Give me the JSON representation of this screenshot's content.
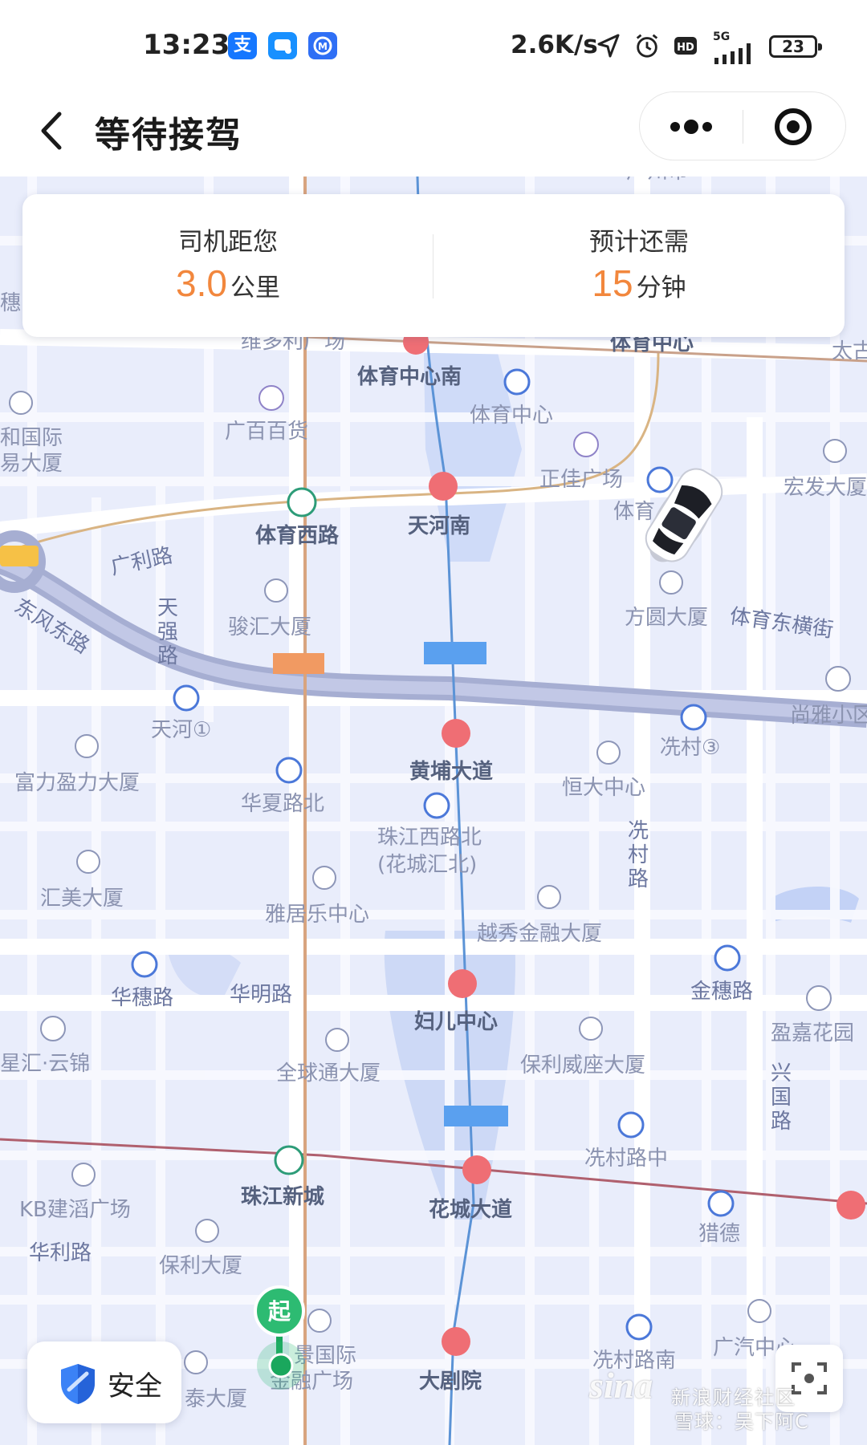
{
  "status_bar": {
    "time": "13:23",
    "net_speed": "2.6K/s",
    "network": "5G",
    "battery": "23",
    "icons": [
      "alipay-app-icon",
      "chat-app-icon",
      "mobile-app-icon",
      "location-arrow-icon",
      "alarm-icon",
      "hd-icon",
      "signal-icon",
      "battery-icon"
    ]
  },
  "header": {
    "title": "等待接驾",
    "back_icon": "chevron-left-icon",
    "more_icon": "more-dots-icon",
    "close_icon": "target-circle-icon"
  },
  "info_card": {
    "distance_label": "司机距您",
    "distance_value": "3.0",
    "distance_unit": "公里",
    "eta_label": "预计还需",
    "eta_value": "15",
    "eta_unit": "分钟"
  },
  "map": {
    "accent_color": "#f2873d",
    "start_marker": "起",
    "labels": [
      "体育中心南",
      "体育中心",
      "体育中心",
      "广百百货",
      "正佳广场",
      "体育",
      "宏发大厦",
      "和国际",
      "易大厦",
      "体育西路",
      "天河南",
      "广利路",
      "天",
      "强",
      "路",
      "东风东路",
      "骏汇大厦",
      "方圆大厦",
      "体育东横街",
      "天河①",
      "尚雅小区",
      "冼村③",
      "黄埔大道",
      "富力盈力大厦",
      "华夏路北",
      "恒大中心",
      "珠江西路北",
      "(花城汇北)",
      "冼",
      "村",
      "路",
      "汇美大厦",
      "雅居乐中心",
      "越秀金融大厦",
      "华穗路",
      "华明路",
      "金穗路",
      "妇儿中心",
      "盈嘉花园",
      "星汇·云锦",
      "全球通大厦",
      "保利威座大厦",
      "兴",
      "国",
      "路",
      "冼村路中",
      "珠江新城",
      "花城大道",
      "KB建滔广场",
      "猎德",
      "华利路",
      "保利大厦",
      "景国际",
      "金融广场",
      "大剧院",
      "冼村路南",
      "广汽中心",
      "泰大厦",
      "太古",
      "穗",
      "维多利广场",
      "广州市"
    ]
  },
  "safety": {
    "label": "安全",
    "icon": "shield-icon"
  },
  "watermark": {
    "logo": "sina",
    "line1": "新浪财经社区",
    "line2": "雪球：吴下阿C"
  }
}
